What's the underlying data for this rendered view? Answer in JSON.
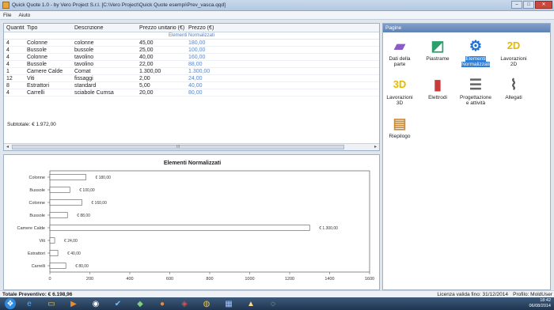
{
  "window": {
    "title": "Quick Quote 1.0 - by Vero Project S.r.l. [C:\\Vero Project\\Quick Quote esempi\\Prev_vasca.qqd]"
  },
  "menu": {
    "file": "File",
    "help": "Aiuto"
  },
  "grid": {
    "headers": [
      "Quantità",
      "Tipo",
      "Descrizione",
      "Prezzo unitario (€)",
      "Prezzo (€)"
    ],
    "group_label": "Elementi Normalizzati",
    "rows": [
      [
        "4",
        "Colonne",
        "colonne",
        "45,00",
        "180,00"
      ],
      [
        "4",
        "Bussole",
        "bussole",
        "25,00",
        "100,00"
      ],
      [
        "4",
        "Colonne",
        "tavolino",
        "40,00",
        "160,00"
      ],
      [
        "4",
        "Bussole",
        "tavolino",
        "22,00",
        "88,00"
      ],
      [
        "1",
        "Camere Calde",
        "Comat",
        "1.300,00",
        "1.300,00"
      ],
      [
        "12",
        "Viti",
        "fissaggi",
        "2,00",
        "24,00"
      ],
      [
        "8",
        "Estrattori",
        "standard",
        "5,00",
        "40,00"
      ],
      [
        "4",
        "Carrelli",
        "sciabole Cumsa",
        "20,00",
        "80,00"
      ]
    ],
    "subtotal": "Subtotale: € 1.972,00",
    "scroll_mid": "III"
  },
  "chart_data": {
    "type": "bar",
    "orientation": "horizontal",
    "title": "Elementi Normalizzati",
    "categories": [
      "Colonne",
      "Bussole",
      "Colonne",
      "Bussole",
      "Camere Calde",
      "Viti",
      "Estrattori",
      "Carrelli"
    ],
    "values": [
      180,
      100,
      160,
      88,
      1300,
      24,
      40,
      80
    ],
    "value_labels": [
      "€ 180,00",
      "€ 100,00",
      "€ 160,00",
      "€ 88,00",
      "€ 1.300,00",
      "€ 24,00",
      "€ 40,00",
      "€ 80,00"
    ],
    "xlim": [
      0,
      1600
    ],
    "xticks": [
      0,
      200,
      400,
      600,
      800,
      1000,
      1200,
      1400,
      1600
    ],
    "bar_color": "#ffffff",
    "bar_border": "#555555"
  },
  "pages_panel": {
    "title": "Pagine",
    "items": [
      {
        "label": "Dati della parte",
        "icon": "part-data-icon",
        "selected": false
      },
      {
        "label": "Piastrame",
        "icon": "plates-icon",
        "selected": false
      },
      {
        "label": "Elementi Normalizzati",
        "icon": "standard-elements-icon",
        "selected": true
      },
      {
        "label": "Lavorazioni 2D",
        "icon": "machining-2d-icon",
        "selected": false
      },
      {
        "label": "Lavorazioni 3D",
        "icon": "machining-3d-icon",
        "selected": false
      },
      {
        "label": "Elettrodi",
        "icon": "electrodes-icon",
        "selected": false
      },
      {
        "label": "Progettazione e attività",
        "icon": "design-activities-icon",
        "selected": false
      },
      {
        "label": "Allegati",
        "icon": "attachments-icon",
        "selected": false
      },
      {
        "label": "Riepilogo",
        "icon": "summary-icon",
        "selected": false
      }
    ]
  },
  "status": {
    "total": "Totale Preventivo: € 6.198,96",
    "license": "Licenza valida fino: 31/12/2014",
    "profile": "Profilo: MoldUser"
  },
  "taskbar": {
    "time": "18:42",
    "date": "06/08/2014"
  },
  "colors": {
    "accent": "#2f7ed8",
    "price_text": "#5b86c4",
    "taskbar": "#1f3550"
  }
}
